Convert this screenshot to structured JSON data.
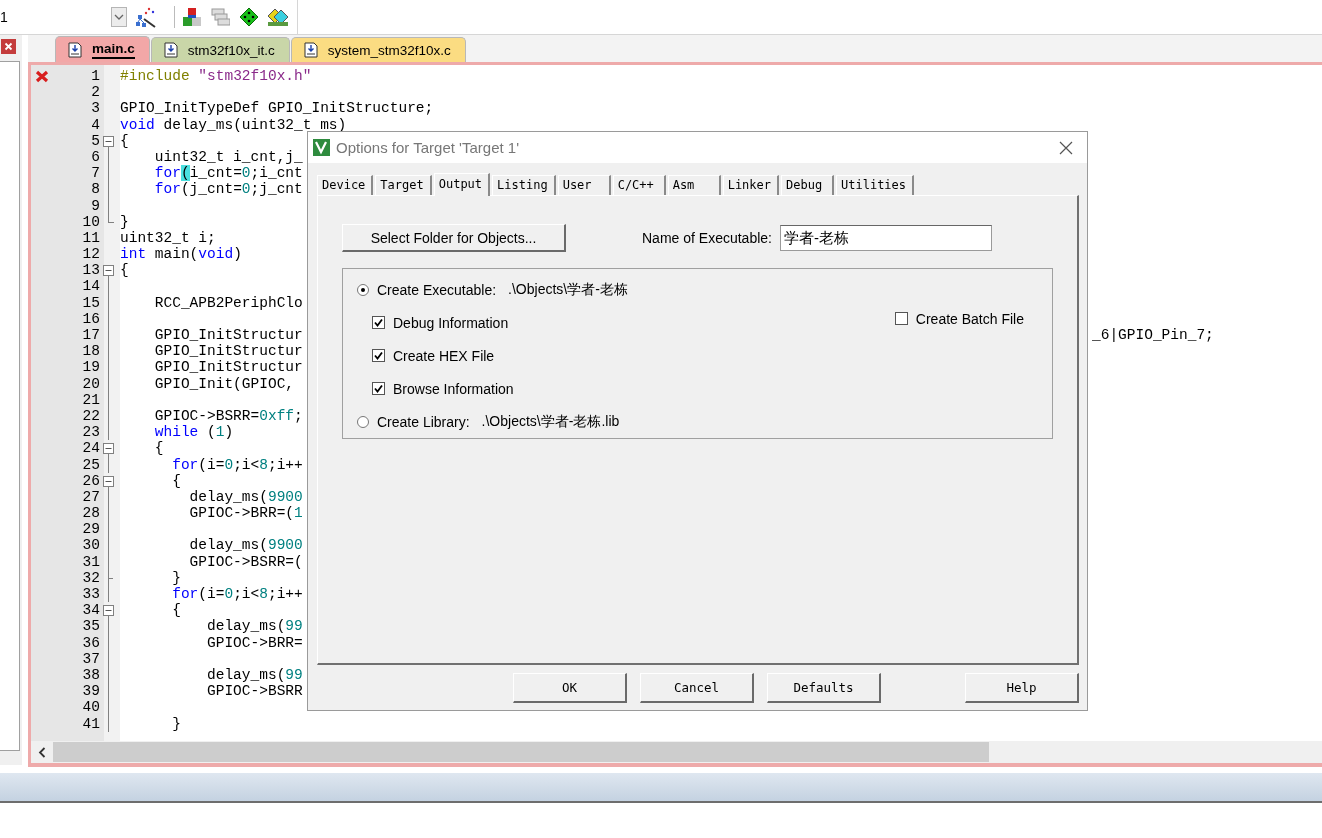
{
  "toolbar": {
    "combo_value": "1"
  },
  "editor": {
    "tabs": [
      {
        "label": "main.c",
        "selected": true,
        "color": "#f2a7a7"
      },
      {
        "label": "stm32f10x_it.c",
        "selected": false,
        "color": "#c9d6a8"
      },
      {
        "label": "system_stm32f10x.c",
        "selected": false,
        "color": "#fbdc82"
      }
    ],
    "lines": [
      {
        "number": "1",
        "error": true,
        "kind": "plain",
        "code": [
          {
            "kind": "preproc",
            "text": "#include "
          },
          {
            "kind": "string",
            "text": "\"stm32f10x.h\""
          }
        ]
      },
      {
        "number": "2",
        "error": false,
        "kind": "plain"
      },
      {
        "number": "3",
        "error": false,
        "kind": "plain",
        "code": [
          {
            "kind": "plain",
            "text": "GPIO_InitTypeDef GPIO_InitStructure;"
          }
        ]
      },
      {
        "number": "4",
        "error": false,
        "kind": "plain",
        "code": [
          {
            "kind": "keyword",
            "text": "void"
          },
          {
            "kind": "plain",
            "text": " delay_ms(uint32_t ms)"
          }
        ]
      },
      {
        "number": "5",
        "error": false,
        "kind": "fold_start",
        "code": [
          {
            "kind": "plain",
            "text": "{"
          }
        ]
      },
      {
        "number": "6",
        "error": false,
        "kind": "fold_body",
        "code": [
          {
            "kind": "plain",
            "text": "    uint32_t i_cnt,j_"
          }
        ]
      },
      {
        "number": "7",
        "error": false,
        "kind": "fold_body",
        "code": [
          {
            "kind": "keyword",
            "text": "    for"
          },
          {
            "kind": "bracket_match",
            "text": "("
          },
          {
            "kind": "plain",
            "text": "i_cnt="
          },
          {
            "kind": "number",
            "text": "0"
          },
          {
            "kind": "plain",
            "text": ";i_cnt"
          }
        ]
      },
      {
        "number": "8",
        "error": false,
        "kind": "fold_body",
        "code": [
          {
            "kind": "keyword",
            "text": "    for"
          },
          {
            "kind": "plain",
            "text": "(j_cnt="
          },
          {
            "kind": "number",
            "text": "0"
          },
          {
            "kind": "plain",
            "text": ";j_cnt"
          }
        ]
      },
      {
        "number": "9",
        "error": false,
        "kind": "fold_body"
      },
      {
        "number": "10",
        "error": false,
        "kind": "fold_end",
        "code": [
          {
            "kind": "plain",
            "text": "}"
          }
        ]
      },
      {
        "number": "11",
        "error": false,
        "kind": "plain",
        "code": [
          {
            "kind": "plain",
            "text": "uint32_t i;"
          }
        ]
      },
      {
        "number": "12",
        "error": false,
        "kind": "plain",
        "code": [
          {
            "kind": "keyword",
            "text": "int"
          },
          {
            "kind": "plain",
            "text": " main("
          },
          {
            "kind": "keyword",
            "text": "void"
          },
          {
            "kind": "plain",
            "text": ")"
          }
        ]
      },
      {
        "number": "13",
        "error": false,
        "kind": "fold_start",
        "code": [
          {
            "kind": "plain",
            "text": "{"
          }
        ]
      },
      {
        "number": "14",
        "error": false,
        "kind": "fold_body"
      },
      {
        "number": "15",
        "error": false,
        "kind": "fold_body",
        "code": [
          {
            "kind": "plain",
            "text": "    RCC_APB2PeriphClo"
          }
        ]
      },
      {
        "number": "16",
        "error": false,
        "kind": "fold_body"
      },
      {
        "number": "17",
        "error": false,
        "kind": "fold_body",
        "code": [
          {
            "kind": "plain",
            "text": "    GPIO_InitStructur"
          }
        ],
        "tail": "_6|GPIO_Pin_7;"
      },
      {
        "number": "18",
        "error": false,
        "kind": "fold_body",
        "code": [
          {
            "kind": "plain",
            "text": "    GPIO_InitStructur"
          }
        ]
      },
      {
        "number": "19",
        "error": false,
        "kind": "fold_body",
        "code": [
          {
            "kind": "plain",
            "text": "    GPIO_InitStructur"
          }
        ]
      },
      {
        "number": "20",
        "error": false,
        "kind": "fold_body",
        "code": [
          {
            "kind": "plain",
            "text": "    GPIO_Init(GPIOC,"
          }
        ]
      },
      {
        "number": "21",
        "error": false,
        "kind": "fold_body"
      },
      {
        "number": "22",
        "error": false,
        "kind": "fold_body",
        "code": [
          {
            "kind": "plain",
            "text": "    GPIOC->BSRR="
          },
          {
            "kind": "number",
            "text": "0xff"
          },
          {
            "kind": "plain",
            "text": ";"
          }
        ]
      },
      {
        "number": "23",
        "error": false,
        "kind": "fold_body",
        "code": [
          {
            "kind": "keyword",
            "text": "    while"
          },
          {
            "kind": "plain",
            "text": " ("
          },
          {
            "kind": "number",
            "text": "1"
          },
          {
            "kind": "plain",
            "text": ")"
          }
        ]
      },
      {
        "number": "24",
        "error": false,
        "kind": "fold_start",
        "code": [
          {
            "kind": "plain",
            "text": "    {"
          }
        ]
      },
      {
        "number": "25",
        "error": false,
        "kind": "fold_body",
        "code": [
          {
            "kind": "keyword",
            "text": "      for"
          },
          {
            "kind": "plain",
            "text": "(i="
          },
          {
            "kind": "number",
            "text": "0"
          },
          {
            "kind": "plain",
            "text": ";i<"
          },
          {
            "kind": "number",
            "text": "8"
          },
          {
            "kind": "plain",
            "text": ";i++"
          }
        ]
      },
      {
        "number": "26",
        "error": false,
        "kind": "fold_start",
        "code": [
          {
            "kind": "plain",
            "text": "      {"
          }
        ]
      },
      {
        "number": "27",
        "error": false,
        "kind": "fold_body",
        "code": [
          {
            "kind": "plain",
            "text": "        delay_ms("
          },
          {
            "kind": "number",
            "text": "9900"
          }
        ]
      },
      {
        "number": "28",
        "error": false,
        "kind": "fold_body",
        "code": [
          {
            "kind": "plain",
            "text": "        GPIOC->BRR=("
          },
          {
            "kind": "number",
            "text": "1"
          }
        ]
      },
      {
        "number": "29",
        "error": false,
        "kind": "fold_body"
      },
      {
        "number": "30",
        "error": false,
        "kind": "fold_body",
        "code": [
          {
            "kind": "plain",
            "text": "        delay_ms("
          },
          {
            "kind": "number",
            "text": "9900"
          }
        ]
      },
      {
        "number": "31",
        "error": false,
        "kind": "fold_body",
        "code": [
          {
            "kind": "plain",
            "text": "        GPIOC->BSRR=("
          }
        ]
      },
      {
        "number": "32",
        "error": false,
        "kind": "fold_inner_end",
        "code": [
          {
            "kind": "plain",
            "text": "      }"
          }
        ]
      },
      {
        "number": "33",
        "error": false,
        "kind": "fold_body",
        "code": [
          {
            "kind": "keyword",
            "text": "      for"
          },
          {
            "kind": "plain",
            "text": "(i="
          },
          {
            "kind": "number",
            "text": "0"
          },
          {
            "kind": "plain",
            "text": ";i<"
          },
          {
            "kind": "number",
            "text": "8"
          },
          {
            "kind": "plain",
            "text": ";i++"
          }
        ]
      },
      {
        "number": "34",
        "error": false,
        "kind": "fold_start",
        "code": [
          {
            "kind": "plain",
            "text": "      {"
          }
        ]
      },
      {
        "number": "35",
        "error": false,
        "kind": "fold_body",
        "code": [
          {
            "kind": "plain",
            "text": "          delay_ms("
          },
          {
            "kind": "number",
            "text": "99"
          }
        ]
      },
      {
        "number": "36",
        "error": false,
        "kind": "fold_body",
        "code": [
          {
            "kind": "plain",
            "text": "          GPIOC->BRR="
          }
        ]
      },
      {
        "number": "37",
        "error": false,
        "kind": "fold_body"
      },
      {
        "number": "38",
        "error": false,
        "kind": "fold_body",
        "code": [
          {
            "kind": "plain",
            "text": "          delay_ms("
          },
          {
            "kind": "number",
            "text": "99"
          }
        ]
      },
      {
        "number": "39",
        "error": false,
        "kind": "fold_body",
        "code": [
          {
            "kind": "plain",
            "text": "          GPIOC->BSRR"
          }
        ]
      },
      {
        "number": "40",
        "error": false,
        "kind": "fold_body"
      },
      {
        "number": "41",
        "error": false,
        "kind": "fold_body",
        "code": [
          {
            "kind": "plain",
            "text": "      }"
          }
        ]
      }
    ]
  },
  "dialog": {
    "title": "Options for Target 'Target 1'",
    "tabs": [
      {
        "label": "Device",
        "selected": false
      },
      {
        "label": "Target",
        "selected": false
      },
      {
        "label": "Output",
        "selected": true
      },
      {
        "label": "Listing",
        "selected": false
      },
      {
        "label": "User",
        "selected": false
      },
      {
        "label": "C/C++",
        "selected": false
      },
      {
        "label": "Asm",
        "selected": false
      },
      {
        "label": "Linker",
        "selected": false
      },
      {
        "label": "Debug",
        "selected": false
      },
      {
        "label": "Utilities",
        "selected": false
      }
    ],
    "select_folder_button": "Select Folder for Objects...",
    "name_label": "Name of Executable:",
    "name_value": "学者-老栋",
    "options": [
      {
        "kind": "radio",
        "label": "Create Executable:",
        "path": ".\\Objects\\学者-老栋",
        "selected": true
      },
      {
        "kind": "checkbox",
        "label": "Debug Information",
        "checked": true
      },
      {
        "kind": "checkbox",
        "label": "Create HEX File",
        "checked": true
      },
      {
        "kind": "checkbox",
        "label": "Browse Information",
        "checked": true
      },
      {
        "kind": "radio",
        "label": "Create Library:",
        "path": ".\\Objects\\学者-老栋.lib",
        "selected": false
      }
    ],
    "batch_file": {
      "label": "Create Batch File",
      "checked": false
    },
    "buttons": [
      "OK",
      "Cancel",
      "Defaults",
      "Help"
    ]
  }
}
